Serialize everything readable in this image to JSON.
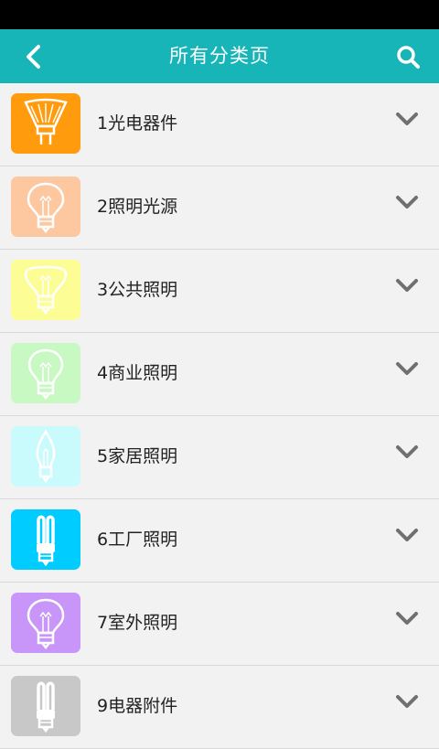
{
  "header": {
    "title": "所有分类页",
    "background": "#17b4b8"
  },
  "categories": [
    {
      "label": "1光电器件",
      "thumb_color": "#ff9b0d",
      "icon": "spotlight-bulb-icon"
    },
    {
      "label": "2照明光源",
      "thumb_color": "#fdc8a0",
      "icon": "bulb-icon"
    },
    {
      "label": "3公共照明",
      "thumb_color": "#fdfd96",
      "icon": "reflector-bulb-icon"
    },
    {
      "label": "4商业照明",
      "thumb_color": "#c9f9c3",
      "icon": "bulb-icon"
    },
    {
      "label": "5家居照明",
      "thumb_color": "#c9fbfd",
      "icon": "candle-bulb-icon"
    },
    {
      "label": "6工厂照明",
      "thumb_color": "#00ccff",
      "icon": "cfl-bulb-icon"
    },
    {
      "label": "7室外照明",
      "thumb_color": "#c896f8",
      "icon": "bulb-icon"
    },
    {
      "label": "9电器附件",
      "thumb_color": "#c8c8c8",
      "icon": "cfl-bulb-icon"
    }
  ]
}
